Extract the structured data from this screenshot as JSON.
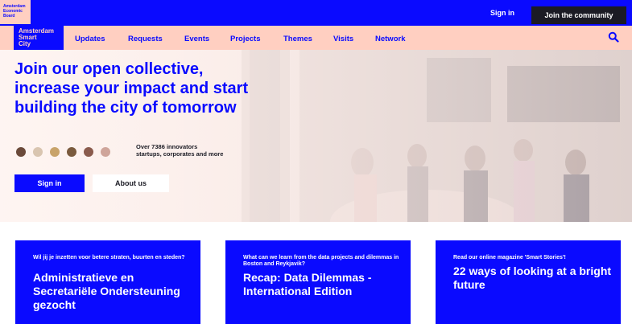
{
  "topbar": {
    "eb_logo": [
      "Amsterdam",
      "Economic",
      "Board"
    ],
    "sign_in": "Sign in",
    "join": "Join the community"
  },
  "nav": {
    "logo": [
      "Amsterdam",
      "Smart",
      "City"
    ],
    "items": [
      "Updates",
      "Requests",
      "Events",
      "Projects",
      "Themes",
      "Visits",
      "Network"
    ],
    "search_icon": "search-icon"
  },
  "hero": {
    "title": "Join our open collective, increase your impact and start building the city of tomorrow",
    "count_line1": "Over 7386 innovators",
    "count_line2": "startups, corporates and more",
    "sign_in": "Sign in",
    "about": "About us"
  },
  "cards": [
    {
      "kicker": "Wil jij je inzetten voor betere straten, buurten en steden?",
      "title": "Administratieve en Secretariële Ondersteuning gezocht"
    },
    {
      "kicker": "What can we learn from the data projects and dilemmas in Boston and Reykjavik?",
      "title": "Recap: Data Dilemmas - International Edition"
    },
    {
      "kicker": "Read our online magazine 'Smart Stories'!",
      "title": "22 ways of looking at a bright future"
    }
  ],
  "colors": {
    "brand_blue": "#0a0aff",
    "brand_pink": "#ffcfc1",
    "dark": "#1b1b24"
  }
}
